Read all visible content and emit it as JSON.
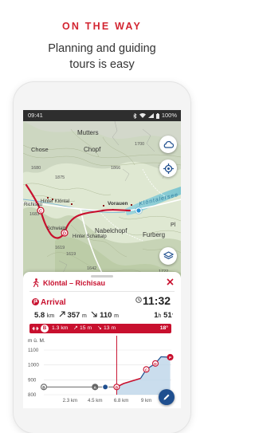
{
  "promo": {
    "heading": "ON THE WAY",
    "subline1": "Planning and guiding",
    "subline2": "tours is easy"
  },
  "statusbar": {
    "time": "09:41",
    "battery": "100%"
  },
  "map": {
    "labels": {
      "mutterschwand": "Mutters",
      "chose": "Chose",
      "chopf": "Chopf",
      "vorauen": "Vorauen",
      "klontalersee": "Klöntalersee",
      "richisau": "Richisau",
      "hinter_klontal": "Hinter Klöntal",
      "schwialp": "Schwialp",
      "hinter_schattalp": "Hinter Schattalp",
      "nabelchopf": "Nabelchopf",
      "furberg": "Furberg",
      "pl": "Pl"
    },
    "spot_heights": [
      "1875",
      "1683",
      "1619",
      "1619",
      "1642",
      "1722",
      "1866",
      "1700",
      "1680"
    ],
    "waypoints": [
      "C",
      "D"
    ],
    "route_color": "#c8102e"
  },
  "route": {
    "title": "Klöntal – Richisau",
    "close_icon": "close-icon",
    "arrival_label": "Arrival",
    "arrival_time": "11:32",
    "distance_value": "5.8",
    "distance_unit": "km",
    "ascent_value": "357",
    "ascent_unit": "m",
    "descent_value": "110",
    "descent_unit": "m",
    "duration_h": "1",
    "duration_h_unit": "h",
    "duration_m": "51",
    "duration_m_unit": "'"
  },
  "segment": {
    "marker": "B",
    "distance": "1.3 km",
    "ascent": "15 m",
    "descent": "13 m",
    "temperature": "18°"
  },
  "elevation": {
    "y_unit": "m ü. M.",
    "y_ticks": [
      "1100",
      "1000",
      "900",
      "800"
    ],
    "x_ticks": [
      "2.3 km",
      "4.5 km",
      "6.8 km",
      "9 km"
    ],
    "points": [
      "B",
      "A",
      "B",
      "C",
      "D",
      "P"
    ]
  },
  "chart_data": {
    "type": "area",
    "ylabel": "m ü. M.",
    "ylim": [
      800,
      1100
    ],
    "x_unit": "km",
    "x": [
      0.0,
      2.5,
      4.5,
      5.4,
      6.4,
      7.0,
      8.5,
      9.0,
      9.8,
      10.3,
      11.1
    ],
    "values": [
      852,
      852,
      852,
      852,
      852,
      875,
      910,
      970,
      1010,
      1055,
      1052
    ]
  }
}
